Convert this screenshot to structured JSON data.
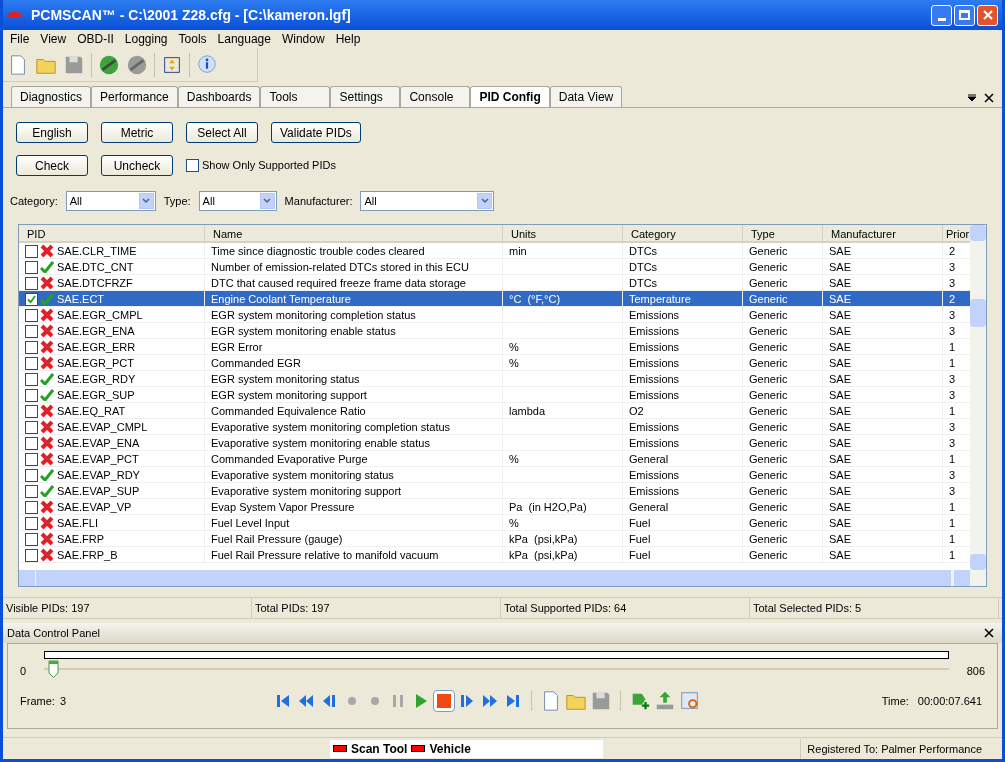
{
  "window": {
    "title": "PCMSCAN™ - C:\\2001 Z28.cfg - [C:\\kameron.lgf]"
  },
  "menu": [
    "File",
    "View",
    "OBD-II",
    "Logging",
    "Tools",
    "Language",
    "Window",
    "Help"
  ],
  "toolbar": [
    {
      "kind": "new",
      "disabled": false
    },
    {
      "kind": "open",
      "disabled": false
    },
    {
      "kind": "save",
      "disabled": true
    },
    {
      "kind": "connect",
      "disabled": false
    },
    {
      "kind": "disconnect",
      "disabled": true
    },
    {
      "kind": "fit",
      "disabled": false
    },
    {
      "kind": "info",
      "disabled": false
    }
  ],
  "tabs": [
    {
      "label": "Diagnostics",
      "selected": false
    },
    {
      "label": "Performance",
      "selected": false
    },
    {
      "label": "Dashboards",
      "selected": false
    },
    {
      "label": "Tools",
      "selected": false
    },
    {
      "label": "Settings",
      "selected": false
    },
    {
      "label": "Console",
      "selected": false
    },
    {
      "label": "PID Config",
      "selected": true
    },
    {
      "label": "Data View",
      "selected": false
    }
  ],
  "buttons_row1": [
    "English",
    "Metric",
    "Select All",
    "Validate PIDs"
  ],
  "buttons_row2": [
    "Check",
    "Uncheck"
  ],
  "show_only_supported": {
    "label": "Show Only Supported PIDs",
    "checked": false
  },
  "filters": [
    {
      "label": "Category:",
      "value": "All"
    },
    {
      "label": "Type:",
      "value": "All"
    },
    {
      "label": "Manufacturer:",
      "value": "All"
    }
  ],
  "table": {
    "columns": [
      "PID",
      "Name",
      "Units",
      "Category",
      "Type",
      "Manufacturer",
      "Prior"
    ],
    "rows": [
      {
        "pid": "SAE.CLR_TIME",
        "supported": false,
        "checked": false,
        "selected": false,
        "name": "Time since diagnostic trouble codes cleared",
        "units": "min",
        "category": "DTCs",
        "type": "Generic",
        "manufacturer": "SAE",
        "priority": "2"
      },
      {
        "pid": "SAE.DTC_CNT",
        "supported": true,
        "checked": false,
        "selected": false,
        "name": "Number of emission-related DTCs stored in this ECU",
        "units": "",
        "category": "DTCs",
        "type": "Generic",
        "manufacturer": "SAE",
        "priority": "3"
      },
      {
        "pid": "SAE.DTCFRZF",
        "supported": false,
        "checked": false,
        "selected": false,
        "name": "DTC that caused required freeze frame data storage",
        "units": "",
        "category": "DTCs",
        "type": "Generic",
        "manufacturer": "SAE",
        "priority": "3"
      },
      {
        "pid": "SAE.ECT",
        "supported": true,
        "checked": true,
        "selected": true,
        "name": "Engine Coolant Temperature",
        "units": "°C  (°F,°C)",
        "category": "Temperature",
        "type": "Generic",
        "manufacturer": "SAE",
        "priority": "2"
      },
      {
        "pid": "SAE.EGR_CMPL",
        "supported": false,
        "checked": false,
        "selected": false,
        "name": "EGR system monitoring completion status",
        "units": "",
        "category": "Emissions",
        "type": "Generic",
        "manufacturer": "SAE",
        "priority": "3"
      },
      {
        "pid": "SAE.EGR_ENA",
        "supported": false,
        "checked": false,
        "selected": false,
        "name": "EGR system monitoring enable status",
        "units": "",
        "category": "Emissions",
        "type": "Generic",
        "manufacturer": "SAE",
        "priority": "3"
      },
      {
        "pid": "SAE.EGR_ERR",
        "supported": false,
        "checked": false,
        "selected": false,
        "name": "EGR Error",
        "units": "%",
        "category": "Emissions",
        "type": "Generic",
        "manufacturer": "SAE",
        "priority": "1"
      },
      {
        "pid": "SAE.EGR_PCT",
        "supported": false,
        "checked": false,
        "selected": false,
        "name": "Commanded EGR",
        "units": "%",
        "category": "Emissions",
        "type": "Generic",
        "manufacturer": "SAE",
        "priority": "1"
      },
      {
        "pid": "SAE.EGR_RDY",
        "supported": true,
        "checked": false,
        "selected": false,
        "name": "EGR system monitoring status",
        "units": "",
        "category": "Emissions",
        "type": "Generic",
        "manufacturer": "SAE",
        "priority": "3"
      },
      {
        "pid": "SAE.EGR_SUP",
        "supported": true,
        "checked": false,
        "selected": false,
        "name": "EGR system monitoring support",
        "units": "",
        "category": "Emissions",
        "type": "Generic",
        "manufacturer": "SAE",
        "priority": "3"
      },
      {
        "pid": "SAE.EQ_RAT",
        "supported": false,
        "checked": false,
        "selected": false,
        "name": "Commanded Equivalence Ratio",
        "units": "lambda",
        "category": "O2",
        "type": "Generic",
        "manufacturer": "SAE",
        "priority": "1"
      },
      {
        "pid": "SAE.EVAP_CMPL",
        "supported": false,
        "checked": false,
        "selected": false,
        "name": "Evaporative system monitoring completion status",
        "units": "",
        "category": "Emissions",
        "type": "Generic",
        "manufacturer": "SAE",
        "priority": "3"
      },
      {
        "pid": "SAE.EVAP_ENA",
        "supported": false,
        "checked": false,
        "selected": false,
        "name": "Evaporative system monitoring enable status",
        "units": "",
        "category": "Emissions",
        "type": "Generic",
        "manufacturer": "SAE",
        "priority": "3"
      },
      {
        "pid": "SAE.EVAP_PCT",
        "supported": false,
        "checked": false,
        "selected": false,
        "name": "Commanded Evaporative Purge",
        "units": "%",
        "category": "General",
        "type": "Generic",
        "manufacturer": "SAE",
        "priority": "1"
      },
      {
        "pid": "SAE.EVAP_RDY",
        "supported": true,
        "checked": false,
        "selected": false,
        "name": "Evaporative system monitoring status",
        "units": "",
        "category": "Emissions",
        "type": "Generic",
        "manufacturer": "SAE",
        "priority": "3"
      },
      {
        "pid": "SAE.EVAP_SUP",
        "supported": true,
        "checked": false,
        "selected": false,
        "name": "Evaporative system monitoring support",
        "units": "",
        "category": "Emissions",
        "type": "Generic",
        "manufacturer": "SAE",
        "priority": "3"
      },
      {
        "pid": "SAE.EVAP_VP",
        "supported": false,
        "checked": false,
        "selected": false,
        "name": "Evap System Vapor Pressure",
        "units": "Pa  (in H2O,Pa)",
        "category": "General",
        "type": "Generic",
        "manufacturer": "SAE",
        "priority": "1"
      },
      {
        "pid": "SAE.FLI",
        "supported": false,
        "checked": false,
        "selected": false,
        "name": "Fuel Level Input",
        "units": "%",
        "category": "Fuel",
        "type": "Generic",
        "manufacturer": "SAE",
        "priority": "1"
      },
      {
        "pid": "SAE.FRP",
        "supported": false,
        "checked": false,
        "selected": false,
        "name": "Fuel Rail Pressure (gauge)",
        "units": "kPa  (psi,kPa)",
        "category": "Fuel",
        "type": "Generic",
        "manufacturer": "SAE",
        "priority": "1"
      },
      {
        "pid": "SAE.FRP_B",
        "supported": false,
        "checked": false,
        "selected": false,
        "name": "Fuel Rail Pressure relative to manifold vacuum",
        "units": "kPa  (psi,kPa)",
        "category": "Fuel",
        "type": "Generic",
        "manufacturer": "SAE",
        "priority": "1"
      }
    ]
  },
  "status_bar": [
    "Visible PIDs: 197",
    "Total PIDs: 197",
    "Total Supported PIDs: 64",
    "Total Selected PIDs: 5"
  ],
  "data_control_panel": {
    "title": "Data Control Panel",
    "min": "0",
    "max": "806",
    "level": 0.004,
    "frame_label": "Frame:",
    "frame": "3",
    "time_label": "Time:",
    "time": "00:00:07.641",
    "media": [
      {
        "kind": "first",
        "disabled": false,
        "selected": false
      },
      {
        "kind": "rewind",
        "disabled": false,
        "selected": false
      },
      {
        "kind": "step-back",
        "disabled": false,
        "selected": false
      },
      {
        "kind": "record",
        "disabled": true,
        "selected": false
      },
      {
        "kind": "record",
        "disabled": true,
        "selected": false
      },
      {
        "kind": "pause",
        "disabled": true,
        "selected": false
      },
      {
        "kind": "play",
        "disabled": false,
        "selected": false
      },
      {
        "kind": "stop",
        "disabled": false,
        "selected": true
      },
      {
        "kind": "step-forward",
        "disabled": false,
        "selected": false
      },
      {
        "kind": "fast-forward",
        "disabled": false,
        "selected": false
      },
      {
        "kind": "last",
        "disabled": false,
        "selected": false
      }
    ],
    "files": [
      {
        "kind": "new",
        "disabled": false
      },
      {
        "kind": "open",
        "disabled": false
      },
      {
        "kind": "save",
        "disabled": true
      },
      {
        "kind": "add",
        "disabled": false
      },
      {
        "kind": "export",
        "disabled": false
      },
      {
        "kind": "zoom",
        "disabled": false
      }
    ]
  },
  "bottom_status": {
    "indicators": [
      {
        "label": "Scan Tool",
        "color": "#ff0000"
      },
      {
        "label": "Vehicle",
        "color": "#ff0000"
      }
    ],
    "registered": "Registered To: Palmer Performance"
  }
}
